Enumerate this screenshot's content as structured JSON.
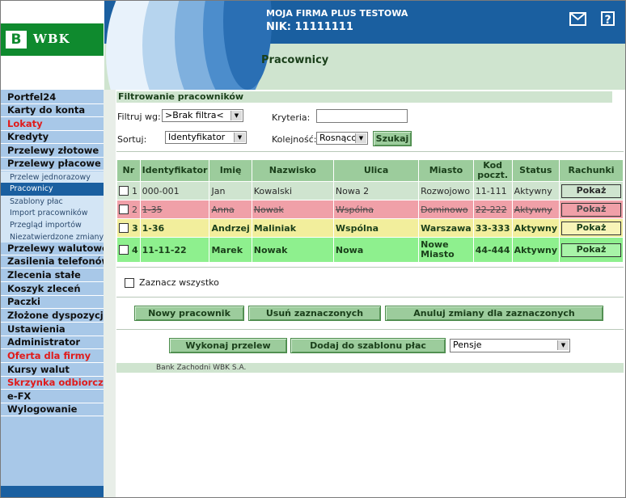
{
  "header": {
    "company": "MOJA FIRMA PLUS TESTOWA",
    "nik": "NIK: 11111111",
    "logo_mark": "B",
    "logo_text": "WBK",
    "page_title": "Pracownicy",
    "help_label": "?",
    "mail_icon": "envelope-icon",
    "help_icon": "question-icon"
  },
  "sidebar": {
    "items": [
      {
        "label": "Portfel24",
        "color": "dark"
      },
      {
        "label": "Karty do konta",
        "color": "dark"
      },
      {
        "label": "Lokaty",
        "color": "red"
      },
      {
        "label": "Kredyty",
        "color": "dark"
      },
      {
        "label": "Przelewy złotowe",
        "color": "dark"
      },
      {
        "label": "Przelewy płacowe",
        "color": "dark"
      },
      {
        "label": "Przelewy walutowe",
        "color": "dark"
      },
      {
        "label": "Zasilenia telefonów",
        "color": "dark"
      },
      {
        "label": "Zlecenia stałe",
        "color": "dark"
      },
      {
        "label": "Koszyk zleceń",
        "color": "dark"
      },
      {
        "label": "Paczki",
        "color": "dark"
      },
      {
        "label": "Złożone dyspozycje",
        "color": "dark"
      },
      {
        "label": "Ustawienia",
        "color": "dark"
      },
      {
        "label": "Administrator",
        "color": "dark"
      },
      {
        "label": "Oferta dla firmy",
        "color": "red"
      },
      {
        "label": "Kursy walut",
        "color": "dark"
      },
      {
        "label": "Skrzynka odbiorcza",
        "color": "red"
      },
      {
        "label": "e-FX",
        "color": "dark"
      },
      {
        "label": "Wylogowanie",
        "color": "dark"
      }
    ],
    "subitems": [
      {
        "label": "Przelew jednorazowy",
        "active": false
      },
      {
        "label": "Pracownicy",
        "active": true
      },
      {
        "label": "Szablony płac",
        "active": false
      },
      {
        "label": "Import pracowników",
        "active": false
      },
      {
        "label": "Przegląd importów",
        "active": false
      },
      {
        "label": "Niezatwierdzone zmiany",
        "active": false
      }
    ]
  },
  "filter": {
    "title": "Filtrowanie pracowników",
    "filter_by_label": "Filtruj wg:",
    "filter_by_value": ">Brak filtra<",
    "criteria_label": "Kryteria:",
    "criteria_value": "",
    "sort_label": "Sortuj:",
    "sort_value": "Identyfikator",
    "order_label": "Kolejność:",
    "order_value": "Rosnąco",
    "search_button": "Szukaj"
  },
  "table": {
    "headers": [
      "Nr",
      "Identyfikator",
      "Imię",
      "Nazwisko",
      "Ulica",
      "Miasto",
      "Kod poczt.",
      "Status",
      "Rachunki"
    ],
    "show_label": "Pokaż",
    "rows": [
      {
        "nr": "1",
        "id": "000-001",
        "first": "Jan",
        "last": "Kowalski",
        "street": "Nowa 2",
        "city": "Rozwojowo",
        "zip": "11-111",
        "status": "Aktywny",
        "state": "normal"
      },
      {
        "nr": "2",
        "id": "1-35",
        "first": "Anna",
        "last": "Nowak",
        "street": "Wspólna",
        "city": "Dominowo",
        "zip": "22-222",
        "status": "Aktywny",
        "state": "deleted"
      },
      {
        "nr": "3",
        "id": "1-36",
        "first": "Andrzej",
        "last": "Maliniak",
        "street": "Wspólna",
        "city": "Warszawa",
        "zip": "33-333",
        "status": "Aktywny",
        "state": "changed"
      },
      {
        "nr": "4",
        "id": "11-11-22",
        "first": "Marek",
        "last": "Nowak",
        "street": "Nowa",
        "city": "Nowe Miasto",
        "zip": "44-444",
        "status": "Aktywny",
        "state": "new"
      }
    ]
  },
  "actions": {
    "select_all": "Zaznacz wszystko",
    "new_employee": "Nowy pracownik",
    "delete_selected": "Usuń zaznaczonych",
    "cancel_changes": "Anuluj zmiany dla zaznaczonych",
    "make_transfer": "Wykonaj przelew",
    "add_to_template": "Dodaj do szablonu płac",
    "template_select": "Pensje"
  },
  "footer": {
    "bank": "Bank Zachodni WBK S.A."
  },
  "colors": {
    "brand_green": "#0f8a2e",
    "header_blue": "#1a5fa0",
    "button_green": "#9ccc9c",
    "row_deleted": "#f0a0a8",
    "row_changed": "#f2ee9c",
    "row_new": "#8ef08e",
    "menu_red": "#e01b1b"
  }
}
